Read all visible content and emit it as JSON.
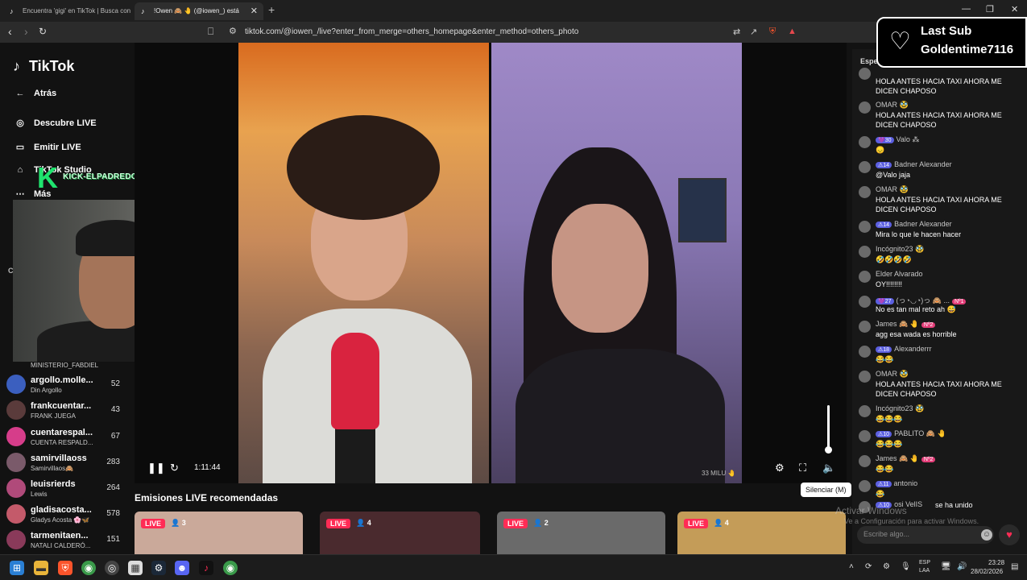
{
  "browser": {
    "tabs": [
      {
        "title": "Encuentra 'gigi' en TikTok | Busca con",
        "favicon": "tiktok-icon"
      },
      {
        "title": "!Owen 🙈 🤚 (@iowen_) está",
        "favicon": "tiktok-icon",
        "close": "✕"
      }
    ],
    "new_tab": "+",
    "url": "tiktok.com/@iowen_/live?enter_from_merge=others_homepage&enter_method=others_photo",
    "window_controls": [
      "—",
      "❐",
      "✕"
    ]
  },
  "sidebar": {
    "logo": "TikTok",
    "back": "Atrás",
    "items": [
      {
        "label": "Descubre LIVE",
        "icon": "live-discover-icon"
      },
      {
        "label": "Emitir LIVE",
        "icon": "camera-icon"
      },
      {
        "label": "TikTok Studio",
        "icon": "studio-home-icon"
      },
      {
        "label": "Más",
        "icon": "more-dots-icon"
      }
    ],
    "partial_letter": "C",
    "streamers": [
      {
        "name": "MINISTERIO_FABDIEL",
        "sub": "",
        "count": ""
      },
      {
        "name": "argollo.molle...",
        "sub": "Din Argollo",
        "count": "52"
      },
      {
        "name": "frankcuentar...",
        "sub": "FRANK JUEGA",
        "count": "43"
      },
      {
        "name": "cuentarespal...",
        "sub": "CUENTA RESPALD...",
        "count": "67"
      },
      {
        "name": "samirvillaoss",
        "sub": "Samirvillaos🙈",
        "count": "283"
      },
      {
        "name": "leuisrierds",
        "sub": "Lewis",
        "count": "264"
      },
      {
        "name": "gladisacosta...",
        "sub": "Gladys Acosta 🌸🦋",
        "count": "578"
      },
      {
        "name": "tarmenitaen...",
        "sub": "NATALI CALDERÓ...",
        "count": "151"
      }
    ]
  },
  "overlay": {
    "kick_letter": "K",
    "kick_channel": "KICK-ELPADREDOMINOOFICIALL"
  },
  "player": {
    "time": "1:11:44",
    "watermark": "33 MILU 🤚",
    "tooltip": "Silenciar (M)",
    "volume_level": 0.9
  },
  "recommended": {
    "title": "Emisiones LIVE recomendadas",
    "cards": [
      {
        "badge": "LIVE",
        "viewers": "3",
        "color": "#caa99a"
      },
      {
        "badge": "LIVE",
        "viewers": "4",
        "color": "#4a2a2e"
      },
      {
        "badge": "LIVE",
        "viewers": "2",
        "color": "#6a6a6a"
      },
      {
        "badge": "LIVE",
        "viewers": "4",
        "color": "#c49c58"
      }
    ]
  },
  "chat": {
    "header": "Espectadores",
    "messages": [
      {
        "badges": "",
        "user": "",
        "extra": "",
        "text": "HOLA ANTES HACIA TAXI AHORA ME DICEN CHAPOSO"
      },
      {
        "badges": "",
        "user": "OMAR 🥸",
        "extra": "",
        "text": "HOLA ANTES HACIA TAXI AHORA ME DICEN CHAPOSO"
      },
      {
        "badges": "💜30",
        "user": "Valo ⁂",
        "extra": "",
        "text": "😞"
      },
      {
        "badges": "⚠14",
        "user": "Badner Alexander",
        "extra": "",
        "text": "@Valo jaja"
      },
      {
        "badges": "",
        "user": "OMAR 🥸",
        "extra": "",
        "text": "HOLA ANTES HACIA TAXI AHORA ME DICEN CHAPOSO"
      },
      {
        "badges": "⚠14",
        "user": "Badner Alexander",
        "extra": "",
        "text": "Mira lo que le hacen hacer"
      },
      {
        "badges": "",
        "user": "Incógnito23 🥸",
        "extra": "",
        "text": "🤣🤣🤣🤣"
      },
      {
        "badges": "",
        "user": "Elder Alvarado",
        "extra": "",
        "text": "OY!!!!!!!!"
      },
      {
        "badges": "💜27",
        "user": "(っ◔◡◔)っ 🙈 ...",
        "extra": "Nº1",
        "text": "No es tan mal reto ah 😅"
      },
      {
        "badges": "",
        "user": "James 🙈 🤚",
        "extra": "Nº2",
        "text": "agg esa wada es horrible"
      },
      {
        "badges": "⚠18",
        "user": "Alexanderrr",
        "extra": "",
        "text": "😂😂"
      },
      {
        "badges": "",
        "user": "OMAR 🥸",
        "extra": "",
        "text": "HOLA ANTES HACIA TAXI AHORA ME DICEN CHAPOSO"
      },
      {
        "badges": "",
        "user": "Incógnito23 🥸",
        "extra": "",
        "text": "😂😂😂"
      },
      {
        "badges": "⚠10",
        "user": "PABLITO 🙈 🤚",
        "extra": "",
        "text": "😂😂😂"
      },
      {
        "badges": "",
        "user": "James 🙈 🤚",
        "extra": "Nº2",
        "text": "😂😂"
      },
      {
        "badges": "⚠11",
        "user": "antonio",
        "extra": "",
        "text": "😂"
      },
      {
        "badges": "⚠10",
        "user": "osi VelIS",
        "extra": "",
        "text": "se ha unido"
      }
    ],
    "input_placeholder": "Escribe algo...",
    "activate_windows_1": "Activar Windows",
    "activate_windows_2": "Ve a Configuración para activar Windows."
  },
  "last_sub": {
    "line1": "Last Sub",
    "line2": "Goldentime7116"
  },
  "taskbar": {
    "lang1": "ESP",
    "lang2": "LAA",
    "time": "23:28",
    "date": "28/02/2026"
  }
}
